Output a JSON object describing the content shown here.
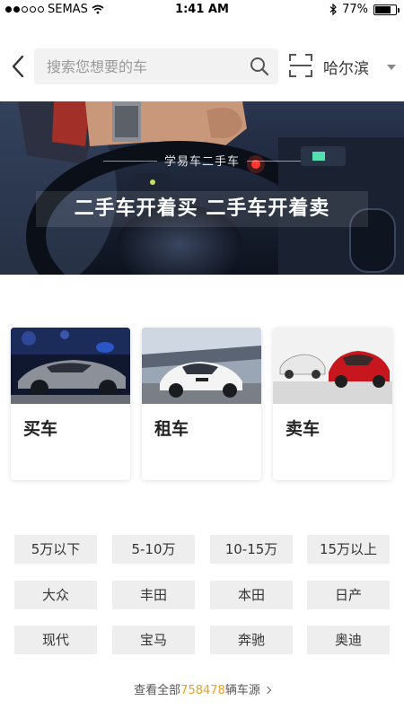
{
  "status_bar": {
    "carrier": "SEMAS",
    "time": "1:41 AM",
    "battery": "77%",
    "battery_level": 0.77,
    "icons": [
      "signal-dots",
      "wifi-icon",
      "bluetooth-icon",
      "battery-icon"
    ]
  },
  "header": {
    "search_placeholder": "搜索您想要的车",
    "city": "哈尔滨",
    "icons": [
      "back-icon",
      "search-icon",
      "scan-icon",
      "dropdown-icon"
    ]
  },
  "banner": {
    "subtitle": "学易车二手车",
    "title": "二手车开着买 二手车开着卖"
  },
  "cards": [
    {
      "label": "买车"
    },
    {
      "label": "租车"
    },
    {
      "label": "卖车"
    }
  ],
  "tags": [
    {
      "label": "5万以下"
    },
    {
      "label": "5-10万"
    },
    {
      "label": "10-15万"
    },
    {
      "label": "15万以上"
    },
    {
      "label": "大众"
    },
    {
      "label": "丰田"
    },
    {
      "label": "本田"
    },
    {
      "label": "日产"
    },
    {
      "label": "现代"
    },
    {
      "label": "宝马"
    },
    {
      "label": "奔驰"
    },
    {
      "label": "奥迪"
    }
  ],
  "footer": {
    "prefix": "查看全部",
    "count": "758478",
    "suffix": "辆车源"
  },
  "colors": {
    "accent_count": "#f0a020",
    "tag_bg": "#eeeeee",
    "search_bg": "#f2f2f2"
  }
}
